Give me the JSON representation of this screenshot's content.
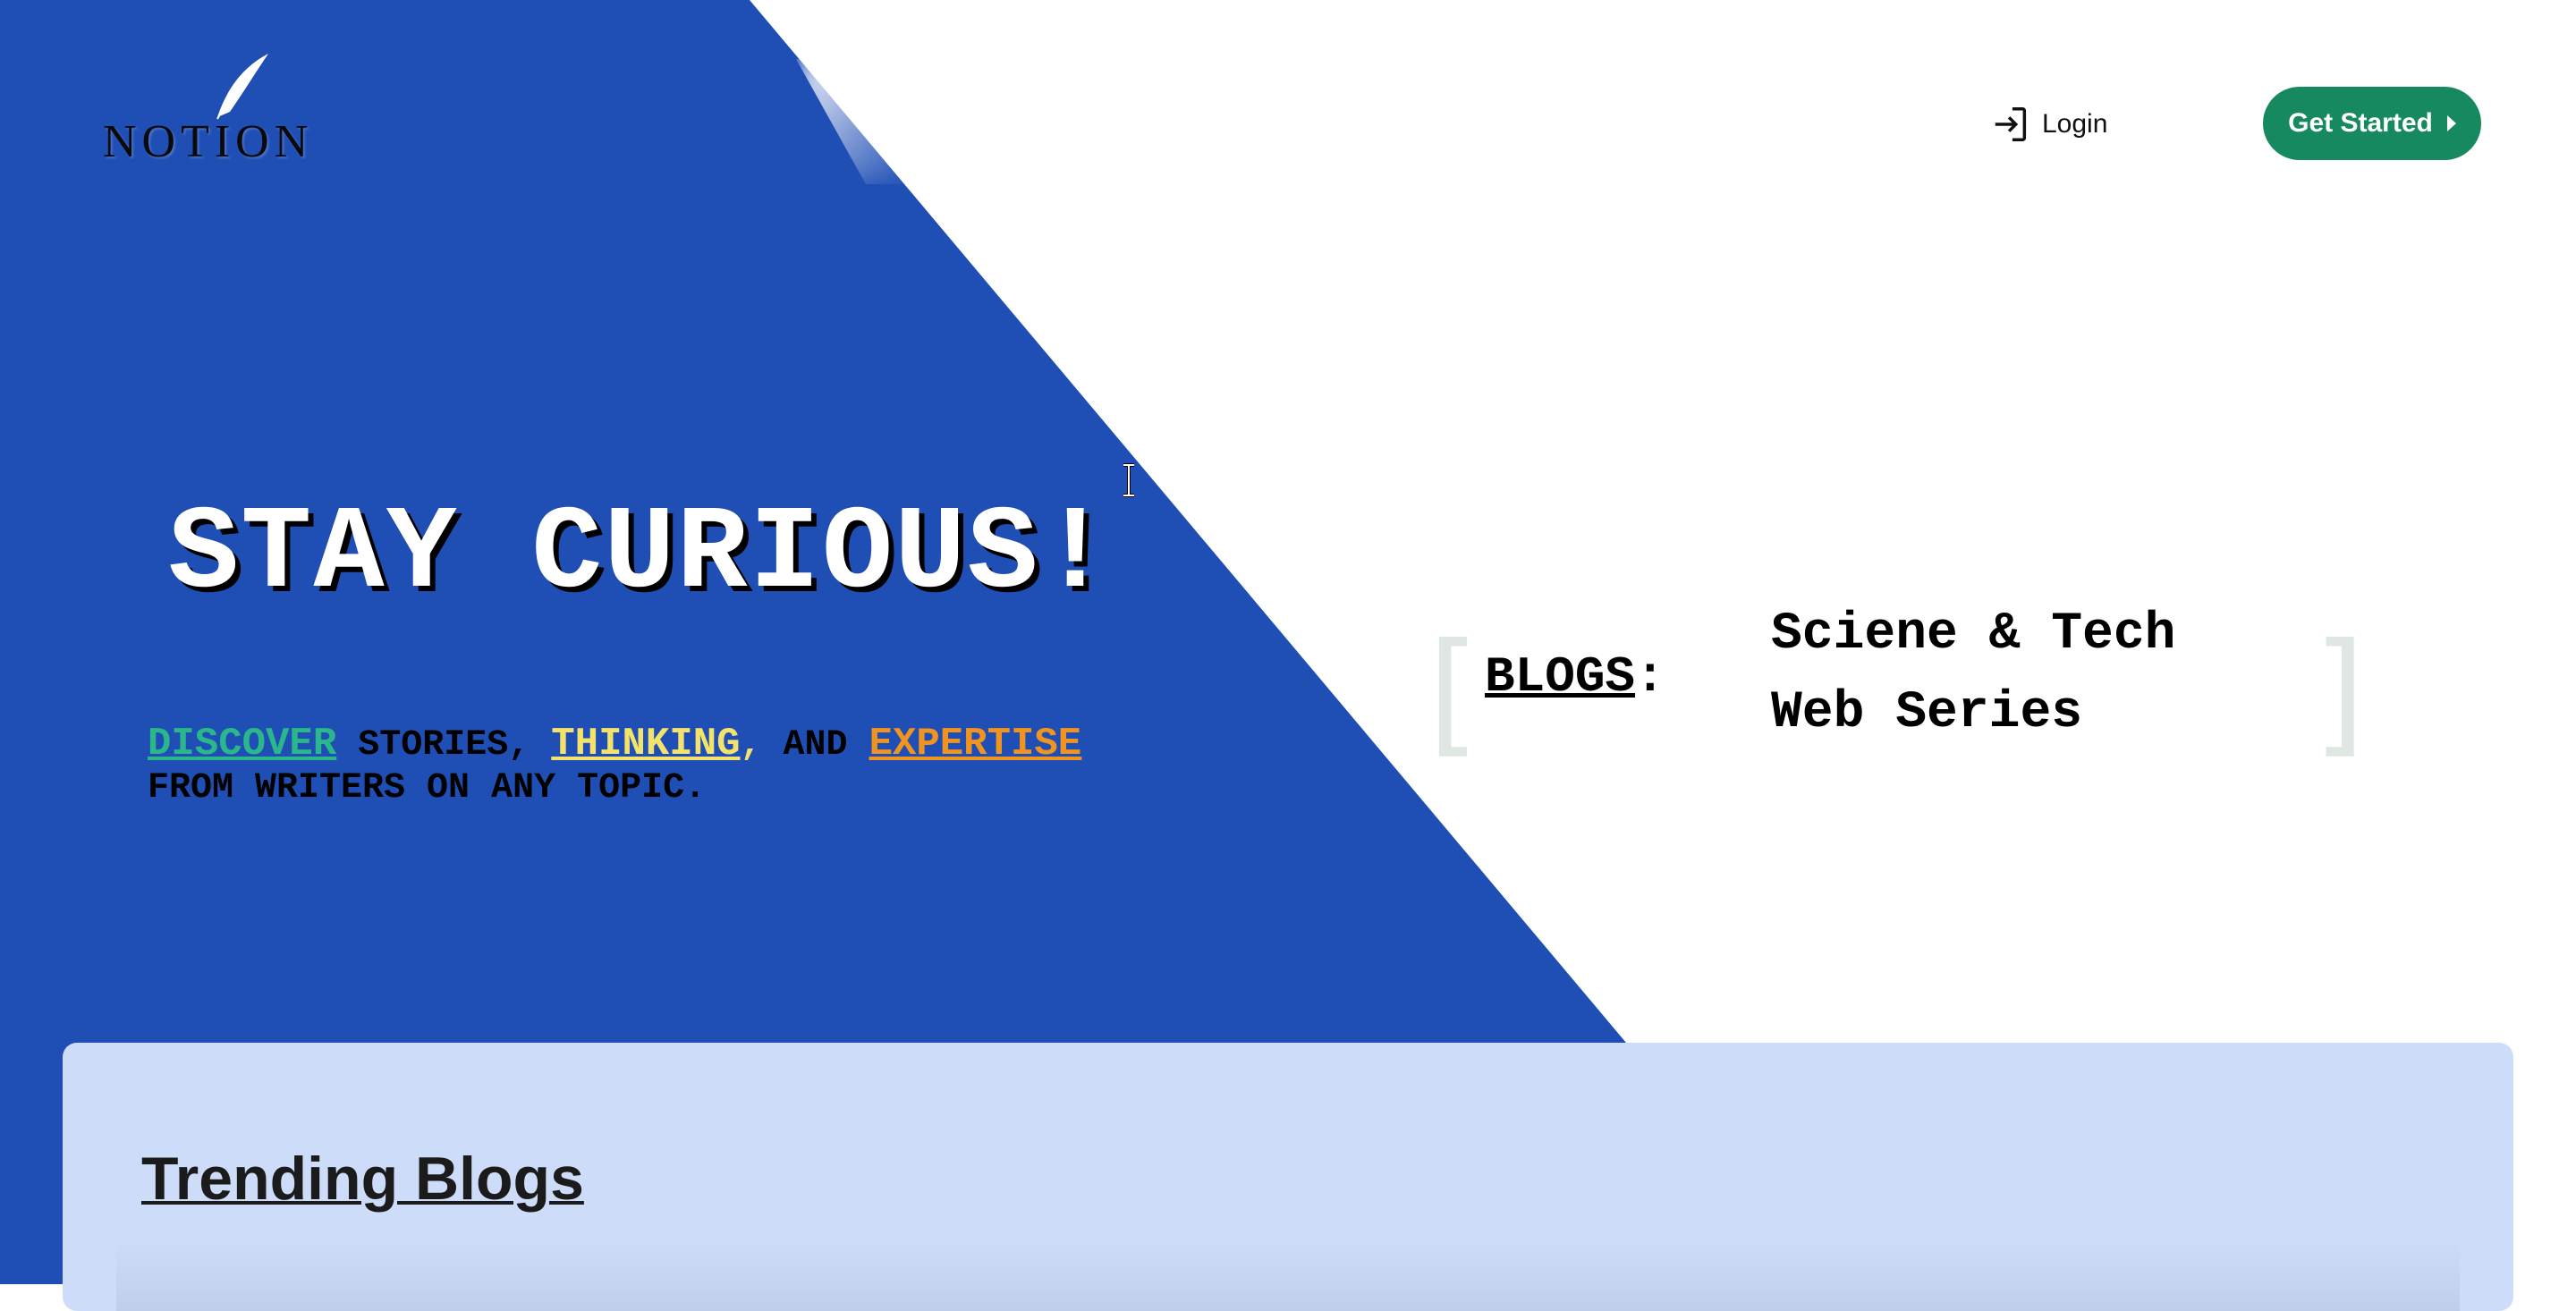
{
  "brand": {
    "logo_text": "NOTION",
    "primary_blue": "#1f4fb5",
    "accent_green": "#168a5e"
  },
  "header": {
    "login_label": "Login",
    "login_icon": "login-icon",
    "cta_label": "Get Started",
    "cta_icon": "chevron-right-icon"
  },
  "hero": {
    "title": "STAY CURIOUS!",
    "tagline": {
      "word1": "DISCOVER",
      "text1": " STORIES, ",
      "word2": "THINKING",
      "text2": ",",
      "text3": " AND ",
      "word3": "EXPERTISE",
      "line2": "FROM WRITERS ON ANY TOPIC."
    }
  },
  "blogs": {
    "label": "BLOGS",
    "colon": ":",
    "items": [
      "Sciene & Tech",
      "Web Series"
    ]
  },
  "trending": {
    "title": "Trending Blogs"
  }
}
